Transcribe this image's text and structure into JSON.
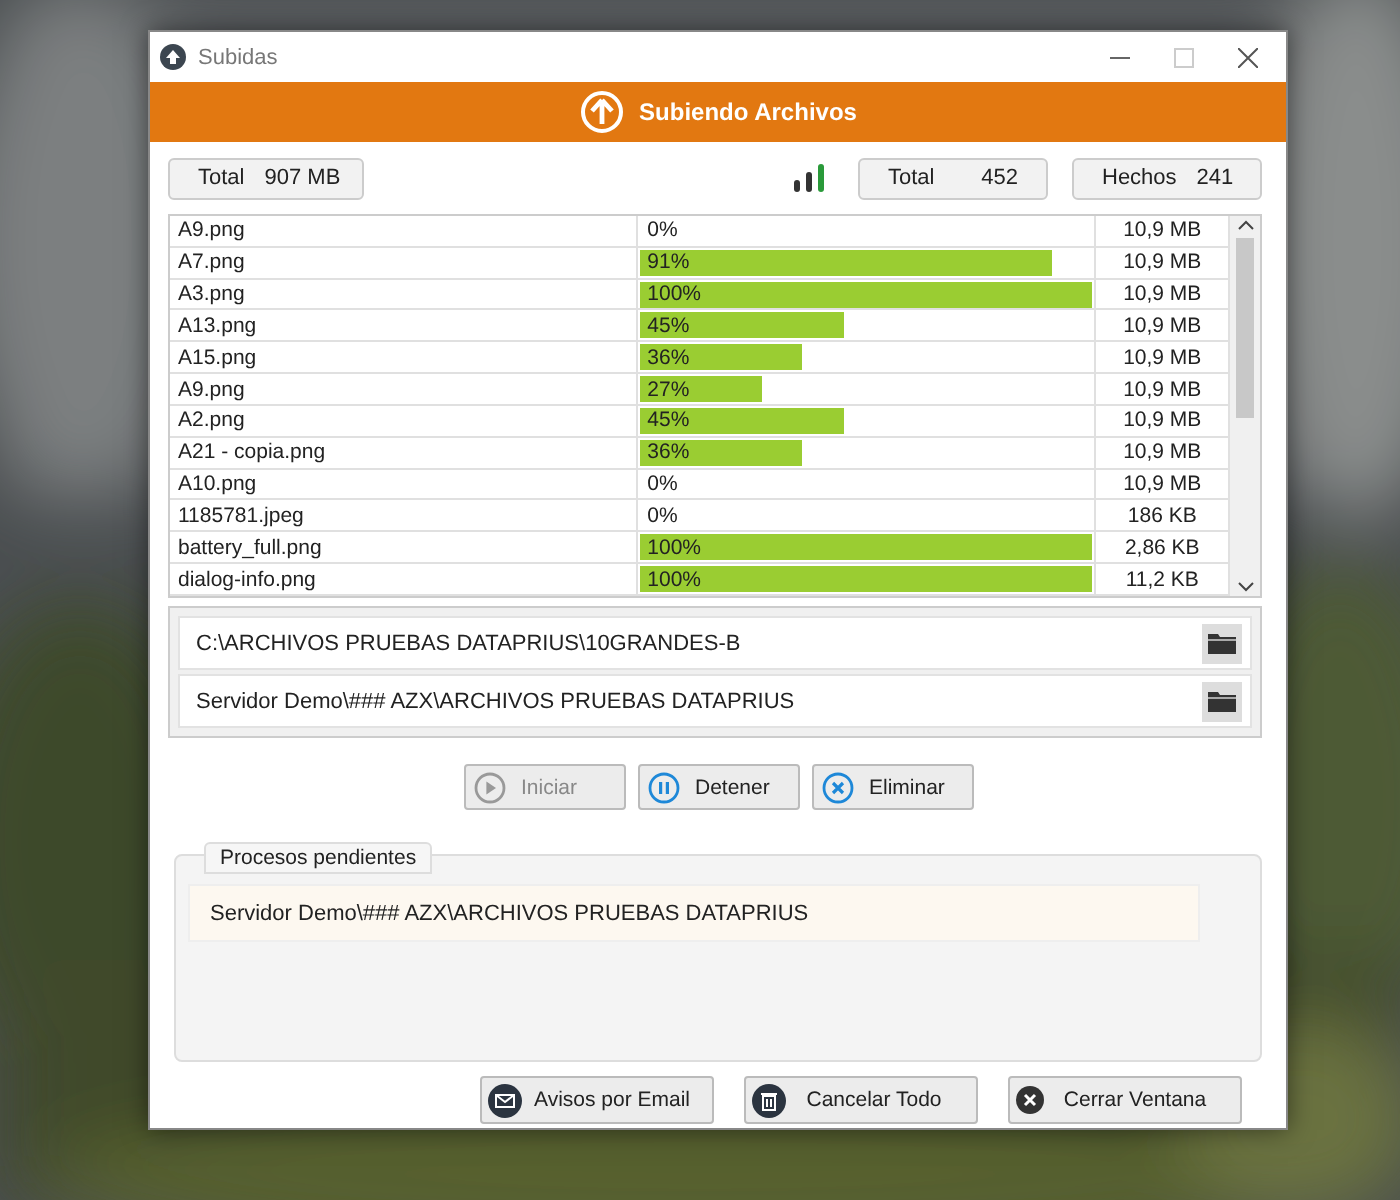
{
  "window": {
    "title": "Subidas"
  },
  "header": {
    "title": "Subiendo Archivos"
  },
  "stats": {
    "size": {
      "label": "Total",
      "value": "907 MB"
    },
    "total": {
      "label": "Total",
      "value": "452"
    },
    "done": {
      "label": "Hechos",
      "value": "241"
    }
  },
  "files": [
    {
      "name": "A9.png",
      "percent": "0%",
      "size": "10,9 MB"
    },
    {
      "name": "A7.png",
      "percent": "91%",
      "level": 0.91,
      "size": "10,9 MB"
    },
    {
      "name": "A3.png",
      "percent": "100%",
      "level": 1,
      "size": "10,9 MB"
    },
    {
      "name": "A13.png",
      "percent": "45%",
      "level": 0.45,
      "size": "10,9 MB"
    },
    {
      "name": "A15.png",
      "percent": "36%",
      "level": 0.36,
      "size": "10,9 MB"
    },
    {
      "name": "A9.png",
      "percent": "27%",
      "level": 0.27,
      "size": "10,9 MB"
    },
    {
      "name": "A2.png",
      "percent": "45%",
      "level": 0.45,
      "size": "10,9 MB"
    },
    {
      "name": "A21 - copia.png",
      "percent": "36%",
      "level": 0.36,
      "size": "10,9 MB"
    },
    {
      "name": "A10.png",
      "percent": "0%",
      "size": "10,9 MB"
    },
    {
      "name": "1185781.jpeg",
      "percent": "0%",
      "size": "186 KB"
    },
    {
      "name": "battery_full.png",
      "percent": "100%",
      "level": 1,
      "size": "2,86 KB"
    },
    {
      "name": "dialog-info.png",
      "percent": "100%",
      "level": 1,
      "size": "11,2 KB"
    }
  ],
  "paths": [
    "C:\\ARCHIVOS PRUEBAS DATAPRIUS\\10GRANDES-B",
    "Servidor Demo\\### AZX\\ARCHIVOS PRUEBAS DATAPRIUS"
  ],
  "actions": [
    {
      "label": "Iniciar",
      "kind": "play",
      "disabled": true
    },
    {
      "label": "Detener",
      "kind": "pause",
      "disabled": false
    },
    {
      "label": "Eliminar",
      "kind": "remove",
      "disabled": false
    }
  ],
  "pending": {
    "title": "Procesos pendientes",
    "items": [
      "Servidor Demo\\### AZX\\ARCHIVOS PRUEBAS DATAPRIUS"
    ]
  },
  "footer_buttons": [
    {
      "label": "Avisos por Email",
      "kind": "mail"
    },
    {
      "label": "Cancelar Todo",
      "kind": "trash"
    },
    {
      "label": "Cerrar Ventana",
      "kind": "close"
    }
  ]
}
